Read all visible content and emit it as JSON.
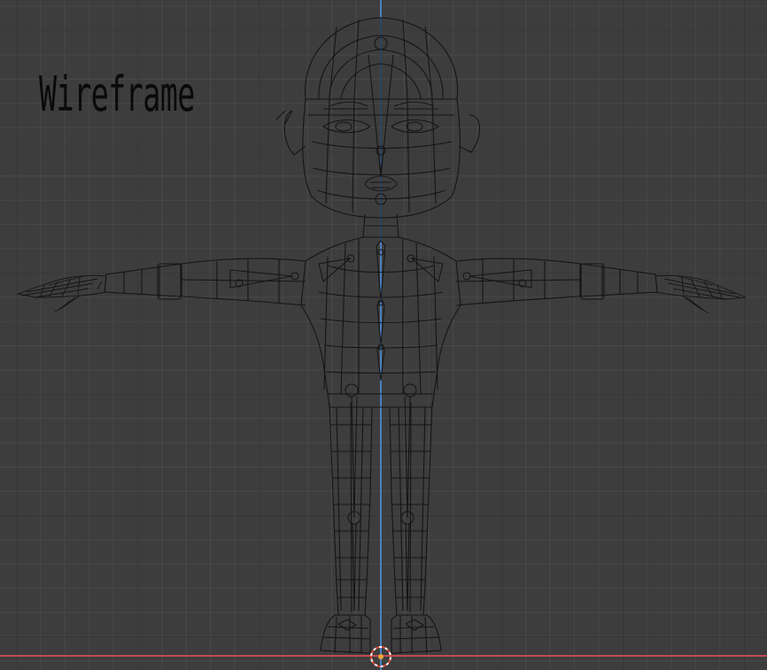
{
  "viewport": {
    "mode_label": "Wireframe",
    "shading_mode": "wireframe"
  },
  "colors": {
    "background": "#3d3d3d",
    "wire": "#151515",
    "axis_z": "#4a7fbf",
    "axis_x": "#c24a52",
    "origin_cursor": "#d4493b"
  },
  "objects": {
    "character_mesh": "t-pose-character"
  }
}
